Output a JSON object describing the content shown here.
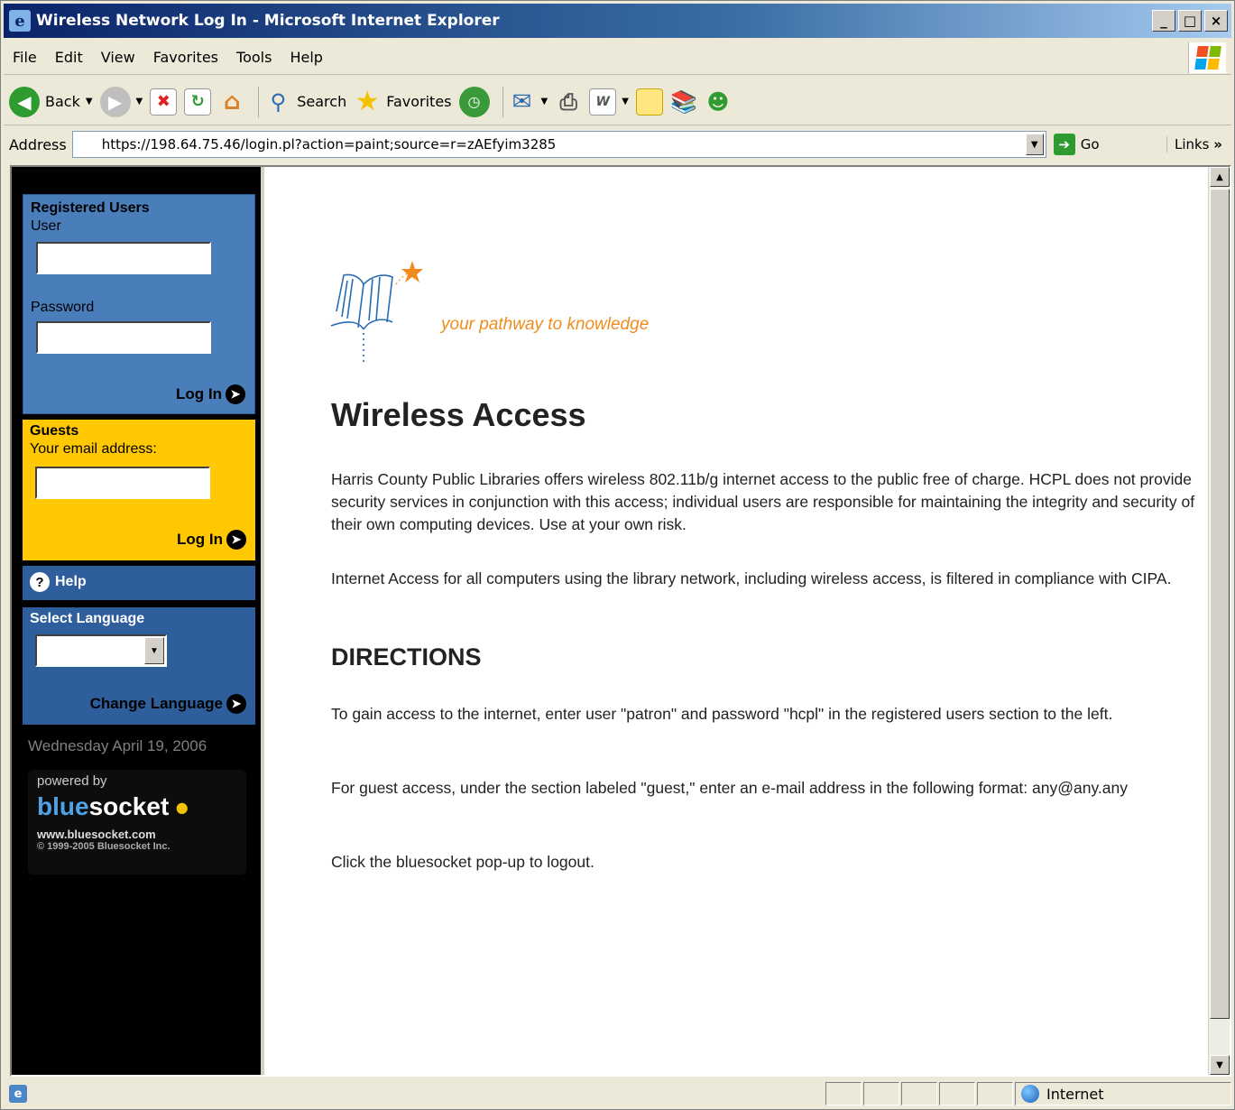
{
  "window": {
    "title": "Wireless Network Log In - Microsoft Internet Explorer",
    "controls": [
      "_",
      "□",
      "×"
    ]
  },
  "menubar": {
    "items": [
      "File",
      "Edit",
      "View",
      "Favorites",
      "Tools",
      "Help"
    ]
  },
  "toolbar": {
    "back_label": "Back",
    "search_label": "Search",
    "favorites_label": "Favorites",
    "icons": [
      "back-icon",
      "forward-icon",
      "stop-icon",
      "refresh-icon",
      "home-icon",
      "search-icon",
      "favorites-star-icon",
      "history-icon",
      "mail-icon",
      "print-icon",
      "edit-word-icon",
      "discuss-icon",
      "research-icon",
      "messenger-icon"
    ]
  },
  "addressbar": {
    "label": "Address",
    "url": "https://198.64.75.46/login.pl?action=paint;source=r=zAEfyim3285",
    "go_label": "Go",
    "links_label": "Links"
  },
  "sidebar": {
    "registered": {
      "heading": "Registered Users",
      "user_label": "User",
      "user_value": "",
      "password_label": "Password",
      "password_value": "",
      "login_label": "Log In"
    },
    "guests": {
      "heading": "Guests",
      "email_label": "Your email address:",
      "email_value": "",
      "login_label": "Log In"
    },
    "help_label": "Help",
    "language": {
      "heading": "Select Language",
      "selected": "",
      "change_label": "Change Language"
    },
    "date": "Wednesday April 19, 2006",
    "bluesocket": {
      "powered_by": "powered by",
      "brand_a": "blue",
      "brand_b": "socket",
      "url": "www.bluesocket.com",
      "copyright": "© 1999-2005  Bluesocket Inc."
    }
  },
  "main": {
    "tagline": "your pathway to knowledge",
    "title": "Wireless Access",
    "para1": "Harris County Public Libraries offers wireless 802.11b/g internet access to the public free of charge. HCPL does not provide security services in conjunction with this access; individual users are responsible for maintaining the integrity and security of their own computing devices. Use at your own risk.",
    "para2": "Internet Access for all computers using the library network, including wireless access, is filtered in compliance with CIPA.",
    "directions_heading": "DIRECTIONS",
    "para3": "To gain access to the internet, enter user \"patron\" and password \"hcpl\" in the registered users section to the left.",
    "para4": "For guest access, under the section labeled \"guest,\" enter an e-mail address in the following format: any@any.any",
    "para5": "Click the bluesocket pop-up to logout."
  },
  "statusbar": {
    "zone_label": "Internet"
  },
  "colors": {
    "registered_panel": "#4a7ebb",
    "guest_panel": "#ffc800",
    "language_panel": "#2f5e9c",
    "tagline": "#f08c1e"
  }
}
